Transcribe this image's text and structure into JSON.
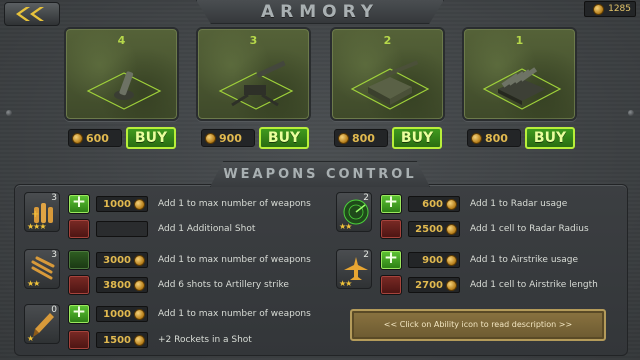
{
  "header": {
    "title": "ARMORY",
    "coins": "1285",
    "back_icon": "double-chevron-left-icon"
  },
  "weapons": [
    {
      "level": "4",
      "price": "600",
      "buy_label": "BUY",
      "kind": "mortar"
    },
    {
      "level": "3",
      "price": "900",
      "buy_label": "BUY",
      "kind": "howitzer"
    },
    {
      "level": "2",
      "price": "800",
      "buy_label": "BUY",
      "kind": "self-propelled-gun"
    },
    {
      "level": "1",
      "price": "800",
      "buy_label": "BUY",
      "kind": "rocket-launcher"
    }
  ],
  "controls": {
    "title": "WEAPONS CONTROL",
    "abilities": [
      {
        "name": "shot",
        "level": "3",
        "stars": "★★★",
        "upgrades": [
          {
            "cost": "1000",
            "text": "Add 1 to max number of weapons"
          },
          {
            "cost": "",
            "text": "Add 1 Additional Shot"
          }
        ]
      },
      {
        "name": "artillery",
        "level": "3",
        "stars": "★★",
        "upgrades": [
          {
            "cost": "3000",
            "text": "Add 1 to max number of weapons"
          },
          {
            "cost": "3800",
            "text": "Add 6 shots to Artillery strike"
          }
        ]
      },
      {
        "name": "rocket",
        "level": "0",
        "stars": "★",
        "upgrades": [
          {
            "cost": "1000",
            "text": "Add 1 to max number of weapons"
          },
          {
            "cost": "1500",
            "text": "+2 Rockets in a Shot"
          }
        ]
      },
      {
        "name": "radar",
        "level": "2",
        "stars": "★★",
        "upgrades": [
          {
            "cost": "600",
            "text": "Add 1 to Radar usage"
          },
          {
            "cost": "2500",
            "text": "Add 1 cell to Radar Radius"
          }
        ]
      },
      {
        "name": "airstrike",
        "level": "2",
        "stars": "★★",
        "upgrades": [
          {
            "cost": "900",
            "text": "Add 1 to Airstrike usage"
          },
          {
            "cost": "2700",
            "text": "Add 1 cell to Airstrike length"
          }
        ]
      }
    ],
    "hint": "<< Click on Ability icon to read description >>"
  },
  "colors": {
    "buy_border": "#b8ef3a",
    "coin": "#e1b94f",
    "panel": "#3c3f42"
  }
}
